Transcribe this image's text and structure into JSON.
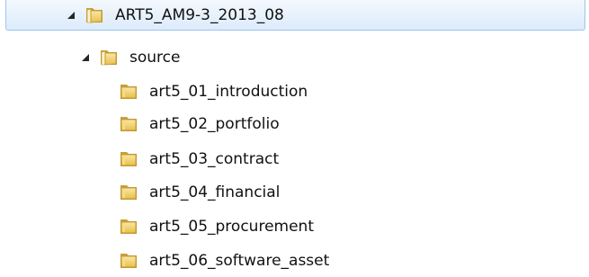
{
  "tree": {
    "root": {
      "label": "ART5_AM9-3_2013_08",
      "expanded": true,
      "icon": "folder-open-icon",
      "children": [
        {
          "label": "source",
          "expanded": true,
          "icon": "folder-open-icon",
          "children": [
            {
              "label": "art5_01_introduction",
              "icon": "folder-icon"
            },
            {
              "label": "art5_02_portfolio",
              "icon": "folder-icon"
            },
            {
              "label": "art5_03_contract",
              "icon": "folder-icon"
            },
            {
              "label": "art5_04_financial",
              "icon": "folder-icon"
            },
            {
              "label": "art5_05_procurement",
              "icon": "folder-icon"
            },
            {
              "label": "art5_06_software_asset",
              "icon": "folder-icon"
            }
          ]
        }
      ]
    },
    "colors": {
      "selection_fill_top": "#f3f8fd",
      "selection_fill_bottom": "#dcebfc",
      "selection_border": "#9fc4ee",
      "folder_yellow": "#f2cf62",
      "folder_shadow": "#c9a13a",
      "text": "#111111"
    }
  }
}
